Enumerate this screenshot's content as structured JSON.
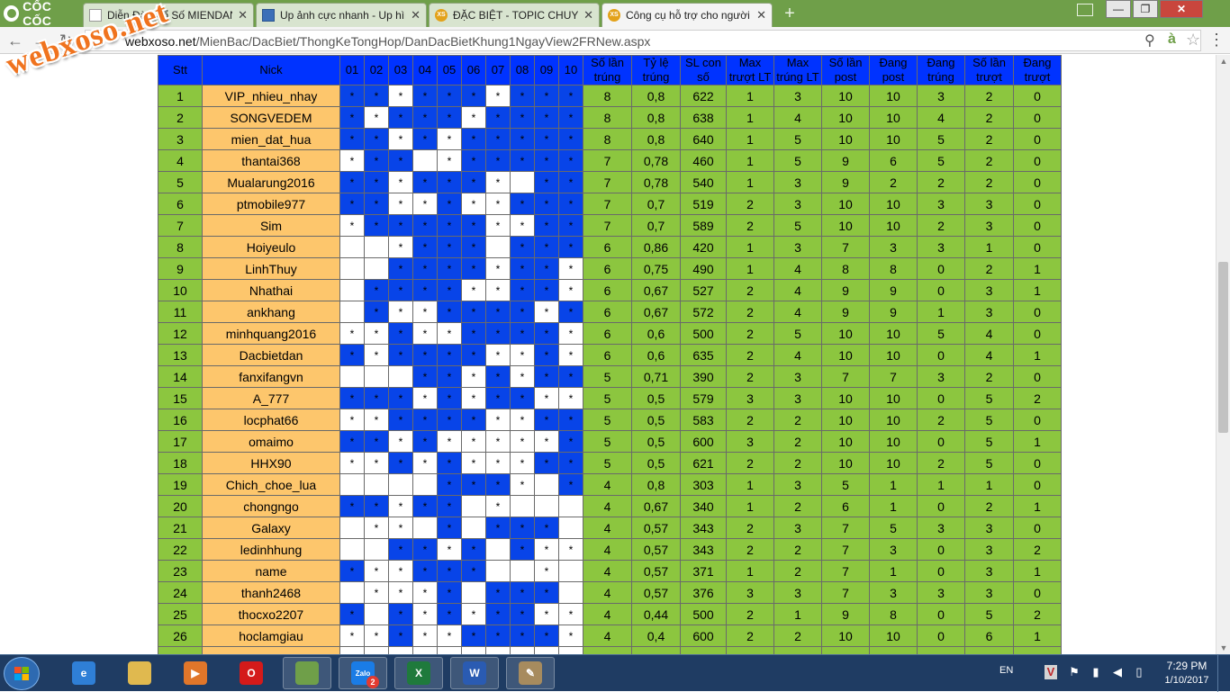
{
  "browser": {
    "brand": "CỐC CỐC",
    "tabs": [
      {
        "title": "Diễn Đàn Xổ Số MIENDAN"
      },
      {
        "title": "Up ảnh cực nhanh - Up hình"
      },
      {
        "title": "ĐẶC BIỆT - TOPIC CHUYÊN"
      },
      {
        "title": "Công cụ hỗ trợ cho người",
        "active": true
      }
    ],
    "url_host": "webxoso.net",
    "url_path": "/MienBac/DacBiet/ThongKeTongHop/DanDacBietKhung1NgayView2FRNew.aspx"
  },
  "watermark": "webxoso.net",
  "table": {
    "headers": [
      "Stt",
      "Nick",
      "01",
      "02",
      "03",
      "04",
      "05",
      "06",
      "07",
      "08",
      "09",
      "10",
      "Số lần trúng",
      "Tỷ lệ trúng",
      "SL con số",
      "Max trượt LT",
      "Max trúng LT",
      "Số lần post",
      "Đang post",
      "Đang trúng",
      "Số lần trượt",
      "Đang trượt"
    ],
    "rows": [
      {
        "stt": "1",
        "nick": "VIP_nhieu_nhay",
        "cells": [
          "b*",
          "b*",
          "w*",
          "b*",
          "b*",
          "b*",
          "w*",
          "b*",
          "b*",
          "b*"
        ],
        "stats": [
          "8",
          "0,8",
          "622",
          "1",
          "3",
          "10",
          "10",
          "3",
          "2",
          "0"
        ]
      },
      {
        "stt": "2",
        "nick": "SONGVEDEM",
        "cells": [
          "b*",
          "w*",
          "b*",
          "b*",
          "b*",
          "w*",
          "b*",
          "b*",
          "b*",
          "b*"
        ],
        "stats": [
          "8",
          "0,8",
          "638",
          "1",
          "4",
          "10",
          "10",
          "4",
          "2",
          "0"
        ]
      },
      {
        "stt": "3",
        "nick": "mien_dat_hua",
        "cells": [
          "b*",
          "b*",
          "w*",
          "b*",
          "w*",
          "b*",
          "b*",
          "b*",
          "b*",
          "b*"
        ],
        "stats": [
          "8",
          "0,8",
          "640",
          "1",
          "5",
          "10",
          "10",
          "5",
          "2",
          "0"
        ]
      },
      {
        "stt": "4",
        "nick": "thantai368",
        "cells": [
          "w*",
          "b*",
          "b*",
          "w",
          "w*",
          "b*",
          "b*",
          "b*",
          "b*",
          "b*"
        ],
        "stats": [
          "7",
          "0,78",
          "460",
          "1",
          "5",
          "9",
          "6",
          "5",
          "2",
          "0"
        ]
      },
      {
        "stt": "5",
        "nick": "Mualarung2016",
        "cells": [
          "b*",
          "b*",
          "w*",
          "b*",
          "b*",
          "b*",
          "w*",
          "w",
          "b*",
          "b*"
        ],
        "stats": [
          "7",
          "0,78",
          "540",
          "1",
          "3",
          "9",
          "2",
          "2",
          "2",
          "0"
        ]
      },
      {
        "stt": "6",
        "nick": "ptmobile977",
        "cells": [
          "b*",
          "b*",
          "w*",
          "w*",
          "b*",
          "w*",
          "w*",
          "b*",
          "b*",
          "b*"
        ],
        "stats": [
          "7",
          "0,7",
          "519",
          "2",
          "3",
          "10",
          "10",
          "3",
          "3",
          "0"
        ]
      },
      {
        "stt": "7",
        "nick": "Sim",
        "cells": [
          "w*",
          "b*",
          "b*",
          "b*",
          "b*",
          "b*",
          "w*",
          "w*",
          "b*",
          "b*"
        ],
        "stats": [
          "7",
          "0,7",
          "589",
          "2",
          "5",
          "10",
          "10",
          "2",
          "3",
          "0"
        ]
      },
      {
        "stt": "8",
        "nick": "Hoiyeulo",
        "cells": [
          "w",
          "w",
          "w*",
          "b*",
          "b*",
          "b*",
          "w",
          "b*",
          "b*",
          "b*"
        ],
        "stats": [
          "6",
          "0,86",
          "420",
          "1",
          "3",
          "7",
          "3",
          "3",
          "1",
          "0"
        ]
      },
      {
        "stt": "9",
        "nick": "LinhThuy",
        "cells": [
          "w",
          "w",
          "b*",
          "b*",
          "b*",
          "b*",
          "w*",
          "b*",
          "b*",
          "w*"
        ],
        "stats": [
          "6",
          "0,75",
          "490",
          "1",
          "4",
          "8",
          "8",
          "0",
          "2",
          "1"
        ]
      },
      {
        "stt": "10",
        "nick": "Nhathai",
        "cells": [
          "w",
          "b*",
          "b*",
          "b*",
          "b*",
          "w*",
          "w*",
          "b*",
          "b*",
          "w*"
        ],
        "stats": [
          "6",
          "0,67",
          "527",
          "2",
          "4",
          "9",
          "9",
          "0",
          "3",
          "1"
        ]
      },
      {
        "stt": "11",
        "nick": "ankhang",
        "cells": [
          "w",
          "b*",
          "w*",
          "w*",
          "b*",
          "b*",
          "b*",
          "b*",
          "w*",
          "b*"
        ],
        "stats": [
          "6",
          "0,67",
          "572",
          "2",
          "4",
          "9",
          "9",
          "1",
          "3",
          "0"
        ]
      },
      {
        "stt": "12",
        "nick": "minhquang2016",
        "cells": [
          "w*",
          "w*",
          "b*",
          "w*",
          "w*",
          "b*",
          "b*",
          "b*",
          "b*",
          "w*"
        ],
        "stats": [
          "6",
          "0,6",
          "500",
          "2",
          "5",
          "10",
          "10",
          "5",
          "4",
          "0"
        ]
      },
      {
        "stt": "13",
        "nick": "Dacbietdan",
        "cells": [
          "b*",
          "w*",
          "b*",
          "b*",
          "b*",
          "b*",
          "w*",
          "w*",
          "b*",
          "w*"
        ],
        "stats": [
          "6",
          "0,6",
          "635",
          "2",
          "4",
          "10",
          "10",
          "0",
          "4",
          "1"
        ]
      },
      {
        "stt": "14",
        "nick": "fanxifangvn",
        "cells": [
          "w",
          "w",
          "w",
          "b*",
          "b*",
          "w*",
          "b*",
          "w*",
          "b*",
          "b*"
        ],
        "stats": [
          "5",
          "0,71",
          "390",
          "2",
          "3",
          "7",
          "7",
          "3",
          "2",
          "0"
        ]
      },
      {
        "stt": "15",
        "nick": "A_777",
        "cells": [
          "b*",
          "b*",
          "b*",
          "w*",
          "b*",
          "w*",
          "b*",
          "b*",
          "w*",
          "w*"
        ],
        "stats": [
          "5",
          "0,5",
          "579",
          "3",
          "3",
          "10",
          "10",
          "0",
          "5",
          "2"
        ]
      },
      {
        "stt": "16",
        "nick": "locphat66",
        "cells": [
          "w*",
          "w*",
          "b*",
          "b*",
          "b*",
          "b*",
          "w*",
          "w*",
          "b*",
          "b*"
        ],
        "stats": [
          "5",
          "0,5",
          "583",
          "2",
          "2",
          "10",
          "10",
          "2",
          "5",
          "0"
        ]
      },
      {
        "stt": "17",
        "nick": "omaimo",
        "cells": [
          "b*",
          "b*",
          "w*",
          "b*",
          "w*",
          "w*",
          "w*",
          "w*",
          "w*",
          "b*"
        ],
        "stats": [
          "5",
          "0,5",
          "600",
          "3",
          "2",
          "10",
          "10",
          "0",
          "5",
          "1"
        ]
      },
      {
        "stt": "18",
        "nick": "HHX90",
        "cells": [
          "w*",
          "w*",
          "b*",
          "w*",
          "b*",
          "w*",
          "w*",
          "w*",
          "b*",
          "b*"
        ],
        "stats": [
          "5",
          "0,5",
          "621",
          "2",
          "2",
          "10",
          "10",
          "2",
          "5",
          "0"
        ]
      },
      {
        "stt": "19",
        "nick": "Chich_choe_lua",
        "cells": [
          "w",
          "w",
          "w",
          "w",
          "b*",
          "b*",
          "b*",
          "w*",
          "w",
          "b*"
        ],
        "stats": [
          "4",
          "0,8",
          "303",
          "1",
          "3",
          "5",
          "1",
          "1",
          "1",
          "0"
        ]
      },
      {
        "stt": "20",
        "nick": "chongngo",
        "cells": [
          "b*",
          "b*",
          "w*",
          "b*",
          "b*",
          "w",
          "w*",
          "w",
          "w",
          "w"
        ],
        "stats": [
          "4",
          "0,67",
          "340",
          "1",
          "2",
          "6",
          "1",
          "0",
          "2",
          "1"
        ]
      },
      {
        "stt": "21",
        "nick": "Galaxy",
        "cells": [
          "w",
          "w*",
          "w*",
          "w",
          "b*",
          "w",
          "b*",
          "b*",
          "b*",
          "w"
        ],
        "stats": [
          "4",
          "0,57",
          "343",
          "2",
          "3",
          "7",
          "5",
          "3",
          "3",
          "0"
        ]
      },
      {
        "stt": "22",
        "nick": "ledinhhung",
        "cells": [
          "w",
          "w",
          "b*",
          "b*",
          "w*",
          "b*",
          "w",
          "b*",
          "w*",
          "w*"
        ],
        "stats": [
          "4",
          "0,57",
          "343",
          "2",
          "2",
          "7",
          "3",
          "0",
          "3",
          "2"
        ]
      },
      {
        "stt": "23",
        "nick": "name",
        "cells": [
          "b*",
          "w*",
          "w*",
          "b*",
          "b*",
          "b*",
          "w",
          "w",
          "w*",
          "w"
        ],
        "stats": [
          "4",
          "0,57",
          "371",
          "1",
          "2",
          "7",
          "1",
          "0",
          "3",
          "1"
        ]
      },
      {
        "stt": "24",
        "nick": "thanh2468",
        "cells": [
          "w",
          "w*",
          "w*",
          "w*",
          "b*",
          "w",
          "b*",
          "b*",
          "b*",
          "w"
        ],
        "stats": [
          "4",
          "0,57",
          "376",
          "3",
          "3",
          "7",
          "3",
          "3",
          "3",
          "0"
        ]
      },
      {
        "stt": "25",
        "nick": "thocxo2207",
        "cells": [
          "b*",
          "w",
          "b*",
          "w*",
          "b*",
          "w*",
          "b*",
          "b*",
          "w*",
          "w*"
        ],
        "stats": [
          "4",
          "0,44",
          "500",
          "2",
          "1",
          "9",
          "8",
          "0",
          "5",
          "2"
        ]
      },
      {
        "stt": "26",
        "nick": "hoclamgiau",
        "cells": [
          "w*",
          "w*",
          "b*",
          "w*",
          "w*",
          "b*",
          "b*",
          "b*",
          "b*",
          "w*"
        ],
        "stats": [
          "4",
          "0,4",
          "600",
          "2",
          "2",
          "10",
          "10",
          "0",
          "6",
          "1"
        ]
      },
      {
        "stt": "",
        "nick": "",
        "cells": [
          "w",
          "w",
          "w",
          "w",
          "w",
          "w",
          "w",
          "w",
          "w",
          "w"
        ],
        "stats": [
          "",
          "",
          "",
          "",
          "",
          "",
          "",
          "",
          "",
          ""
        ]
      }
    ]
  },
  "taskbar": {
    "apps": [
      {
        "name": "internet-explorer",
        "glyph": "e",
        "color": "#2f7fd6"
      },
      {
        "name": "file-explorer",
        "glyph": "",
        "color": "#e0b94f"
      },
      {
        "name": "media-player",
        "glyph": "▶",
        "color": "#e0762a"
      },
      {
        "name": "opera",
        "glyph": "O",
        "color": "#d41a1a"
      },
      {
        "name": "coccoc",
        "glyph": "",
        "color": "#6f9f49",
        "open": true
      },
      {
        "name": "zalo",
        "glyph": "Zalo",
        "color": "#1a7ce6",
        "badge": "2",
        "open": true
      },
      {
        "name": "excel",
        "glyph": "X",
        "color": "#1f7a3c",
        "open": true
      },
      {
        "name": "word",
        "glyph": "W",
        "color": "#2a5bb2",
        "open": true
      },
      {
        "name": "paint",
        "glyph": "✎",
        "color": "#a78b5e",
        "open": true
      }
    ],
    "lang": "EN",
    "time": "7:29 PM",
    "date": "1/10/2017"
  }
}
